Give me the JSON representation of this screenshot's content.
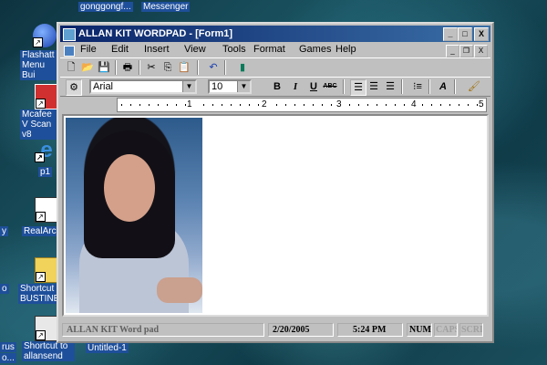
{
  "desktop": {
    "icons": [
      {
        "label": "Flashatt Menu Bui"
      },
      {
        "label": "Mcafee V Scan v8"
      },
      {
        "label": "p1"
      },
      {
        "label": "RealArca"
      },
      {
        "label": "Shortcut ( BUSTINER"
      },
      {
        "label": "Shortcut to allansend"
      }
    ],
    "top_labels": [
      "gonggongf...",
      "Messenger"
    ],
    "edge_labels": [
      "y",
      "o",
      "rus",
      "o..."
    ],
    "task_label": "Untitled-1"
  },
  "window": {
    "title": "ALLAN KIT WORDPAD - [Form1]",
    "controls": {
      "minimize": "_",
      "maximize": "□",
      "close": "X"
    },
    "mdi_controls": {
      "minimize": "_",
      "restore": "❐",
      "close": "X"
    }
  },
  "menu": [
    "File",
    "Edit",
    "Insert",
    "View",
    "Tools",
    "Format",
    "Games",
    "Help"
  ],
  "toolbar": {
    "icons": [
      "new-doc-icon",
      "open-folder-icon",
      "save-icon",
      "print-icon",
      "cut-icon",
      "copy-icon",
      "paste-icon",
      "undo-icon",
      "book-icon"
    ]
  },
  "format_bar": {
    "font": "Arial",
    "size": "10",
    "bold": "B",
    "italic": "I",
    "underline": "U",
    "strike": "ABC"
  },
  "ruler": {
    "numbers": [
      "1",
      "2",
      "3",
      "4",
      "5"
    ]
  },
  "statusbar": {
    "app_name": "ALLAN KIT Word pad",
    "date": "2/20/2005",
    "time": "5:24 PM",
    "num": "NUM",
    "caps": "CAPS",
    "scroll": "SCRL"
  }
}
